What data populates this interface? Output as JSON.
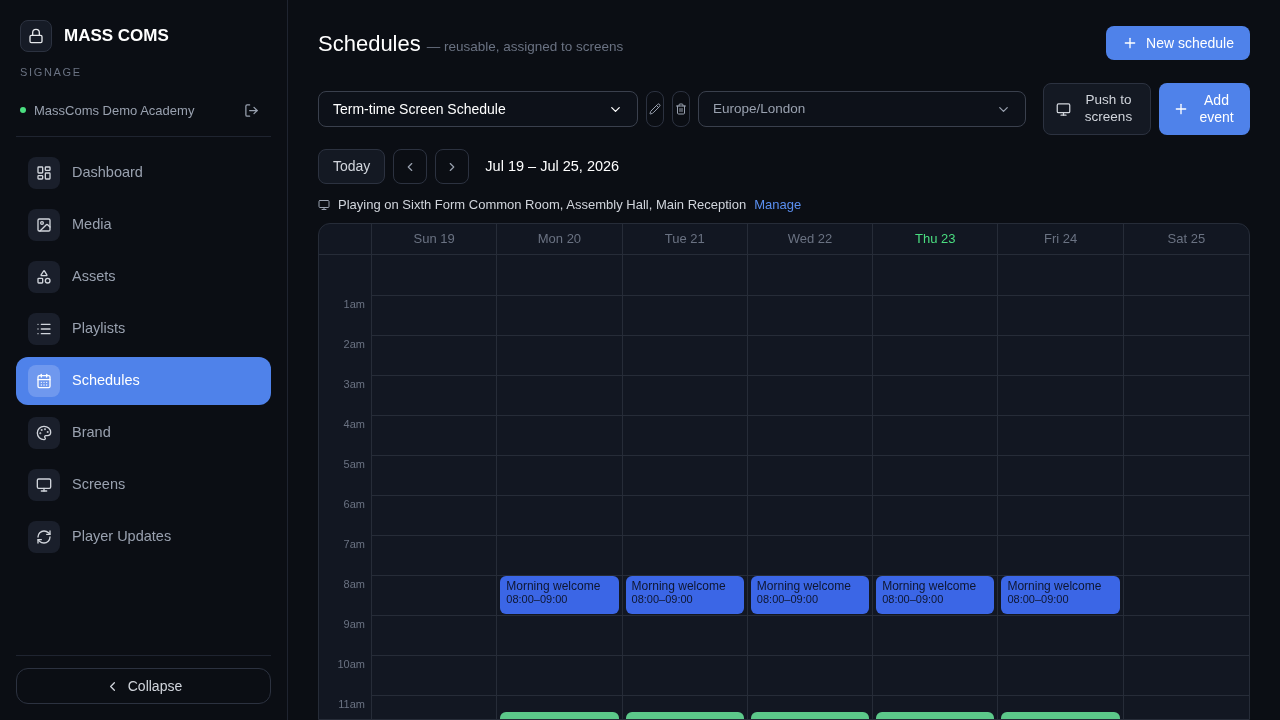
{
  "brand": {
    "name": "MASS COMS",
    "subtitle": "SIGNAGE",
    "org": "MassComs Demo Academy",
    "online": true
  },
  "nav": [
    {
      "label": "Dashboard",
      "selected": false
    },
    {
      "label": "Media",
      "selected": false
    },
    {
      "label": "Assets",
      "selected": false
    },
    {
      "label": "Playlists",
      "selected": false
    },
    {
      "label": "Schedules",
      "selected": true
    },
    {
      "label": "Brand",
      "selected": false
    },
    {
      "label": "Screens",
      "selected": false
    },
    {
      "label": "Player Updates",
      "selected": false
    }
  ],
  "collapse": "Collapse",
  "header": {
    "title": "Schedules",
    "subtitle": "— reusable, assigned to screens",
    "new_button": "New schedule"
  },
  "toolbar": {
    "schedule": "Term-time Screen Schedule",
    "timezone": "Europe/London",
    "push_button": "Push to screens",
    "add_button": "Add event"
  },
  "nav_bar": {
    "today": "Today",
    "range": "Jul 19 – Jul 25, 2026"
  },
  "playing": {
    "text": "Playing on Sixth Form Common Room, Assembly Hall, Main Reception",
    "link": "Manage"
  },
  "calendar": {
    "hours": [
      "1am",
      "2am",
      "3am",
      "4am",
      "5am",
      "6am",
      "7am",
      "8am",
      "9am",
      "10am",
      "11am"
    ],
    "days": [
      {
        "label": "Sun 19",
        "today": false
      },
      {
        "label": "Mon 20",
        "today": false,
        "events": [
          {
            "title": "Morning welcome",
            "time": "08:00–09:00",
            "color": "#3b66e6"
          },
          {
            "color": "#5cc98a"
          }
        ]
      },
      {
        "label": "Tue 21",
        "today": false,
        "events": [
          {
            "title": "Morning welcome",
            "time": "08:00–09:00",
            "color": "#3b66e6"
          },
          {
            "color": "#5cc98a"
          }
        ]
      },
      {
        "label": "Wed 22",
        "today": false,
        "events": [
          {
            "title": "Morning welcome",
            "time": "08:00–09:00",
            "color": "#3b66e6"
          },
          {
            "color": "#5cc98a"
          }
        ]
      },
      {
        "label": "Thu 23",
        "today": true,
        "events": [
          {
            "title": "Morning welcome",
            "time": "08:00–09:00",
            "color": "#3b66e6"
          },
          {
            "color": "#5cc98a"
          }
        ]
      },
      {
        "label": "Fri 24",
        "today": false,
        "events": [
          {
            "title": "Morning welcome",
            "time": "08:00–09:00",
            "color": "#3b66e6"
          },
          {
            "color": "#5cc98a"
          }
        ]
      },
      {
        "label": "Sat 25",
        "today": false
      }
    ]
  }
}
